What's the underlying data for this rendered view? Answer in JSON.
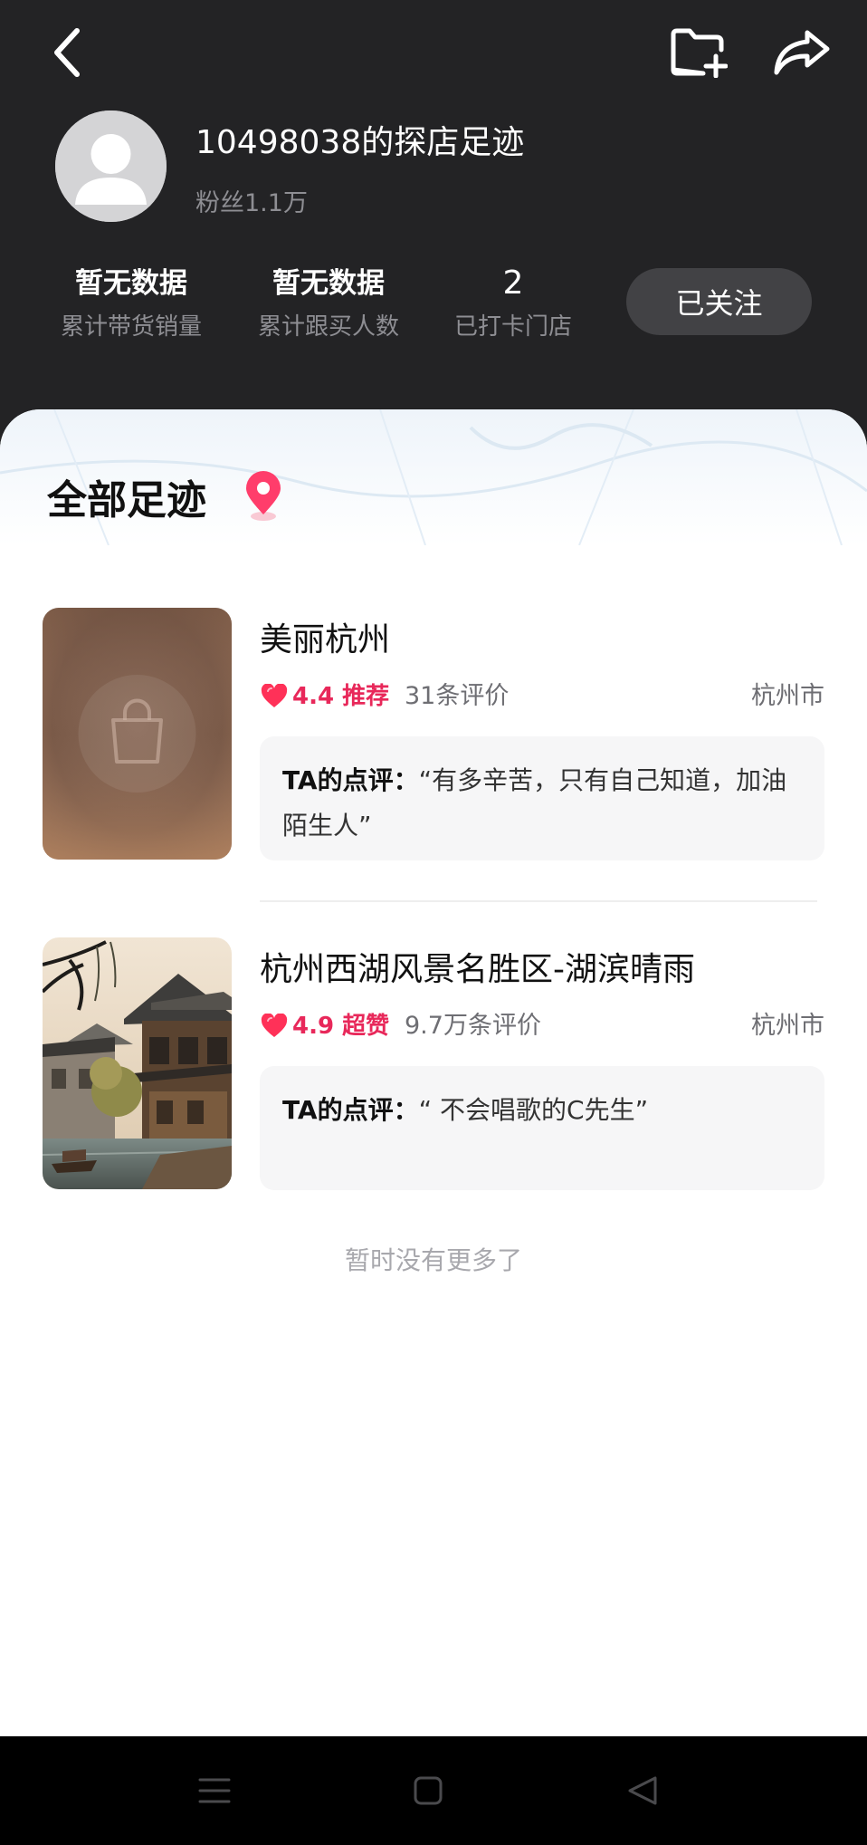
{
  "header": {
    "back_icon": "chevron-left-icon",
    "favorite_icon": "folder-plus-icon",
    "share_icon": "share-arrow-icon"
  },
  "profile": {
    "name": "10498038的探店足迹",
    "fans": "粉丝1.1万",
    "avatar_icon": "default-user-avatar"
  },
  "stats": [
    {
      "value": "暂无数据",
      "label": "累计带货销量"
    },
    {
      "value": "暂无数据",
      "label": "累计跟买人数"
    },
    {
      "value": "2",
      "label": "已打卡门店"
    }
  ],
  "follow_button": "已关注",
  "section": {
    "title": "全部足迹",
    "title_icon": "map-pin-icon"
  },
  "items": [
    {
      "name": "美丽杭州",
      "rating": "4.4 推荐",
      "reviews": "31条评价",
      "city": "杭州市",
      "review_prefix": "TA的点评：",
      "review_text": "“有多辛苦，只有自己知道，加油陌生人”",
      "thumb_icon": "shopping-bag-icon"
    },
    {
      "name": "杭州西湖风景名胜区-湖滨晴雨",
      "rating": "4.9 超赞",
      "reviews": "9.7万条评价",
      "city": "杭州市",
      "review_prefix": "TA的点评：",
      "review_text": "“  不会唱歌的C先生”",
      "thumb_icon": "water-town-photo"
    }
  ],
  "footer_text": "暂时没有更多了",
  "navbar": {
    "menu_icon": "menu-lines-icon",
    "home_icon": "square-home-icon",
    "back_icon": "triangle-back-icon"
  },
  "colors": {
    "header_bg": "#232325",
    "accent": "#e8285a",
    "follow_button_bg": "#424245",
    "review_box_bg": "#f6f6f7"
  }
}
